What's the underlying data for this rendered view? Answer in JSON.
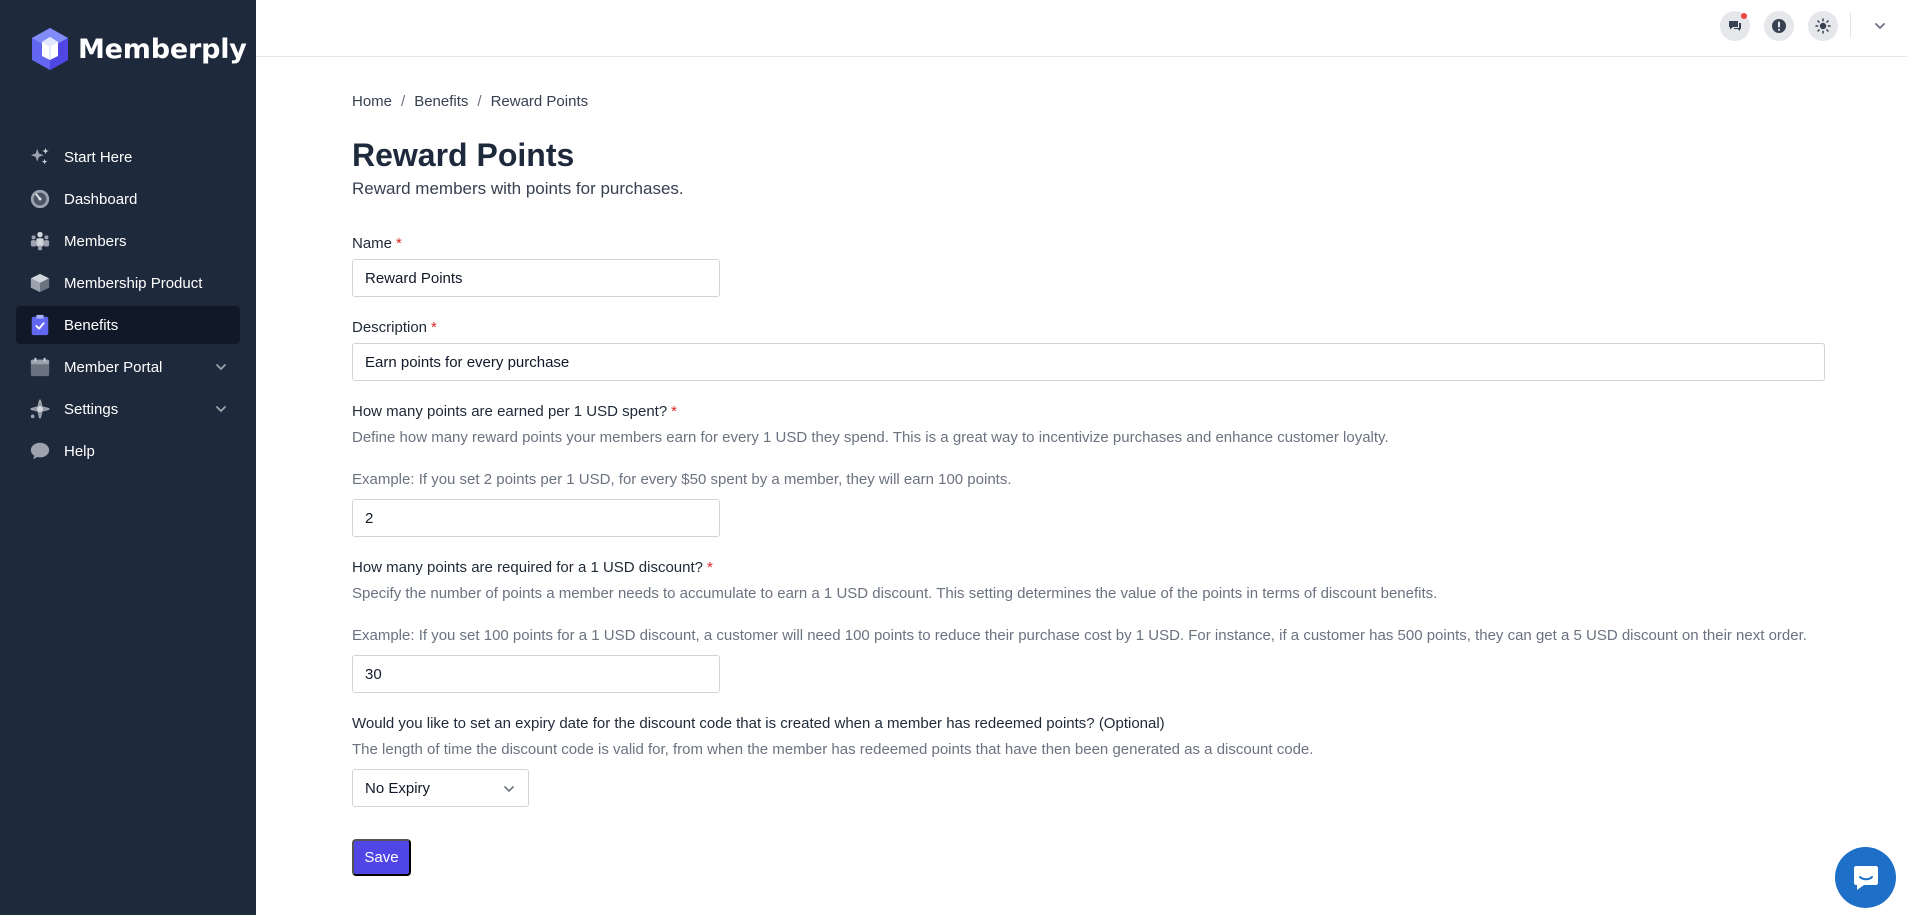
{
  "app": {
    "name": "Memberply"
  },
  "sidebar": {
    "items": [
      {
        "label": "Start Here",
        "icon": "sparkles-icon"
      },
      {
        "label": "Dashboard",
        "icon": "gauge-icon"
      },
      {
        "label": "Members",
        "icon": "users-icon"
      },
      {
        "label": "Membership Product",
        "icon": "cube-icon"
      },
      {
        "label": "Benefits",
        "icon": "clipboard-check-icon",
        "active": true
      },
      {
        "label": "Member Portal",
        "icon": "calendar-icon",
        "expandable": true
      },
      {
        "label": "Settings",
        "icon": "settings-icon",
        "expandable": true
      },
      {
        "label": "Help",
        "icon": "chat-bubble-icon"
      }
    ]
  },
  "topbar": {
    "icons": [
      "chat-icon",
      "alert-icon",
      "sun-icon",
      "chevron-down-icon"
    ]
  },
  "breadcrumb": [
    "Home",
    "Benefits",
    "Reward Points"
  ],
  "breadcrumb_separator": "/",
  "page": {
    "title": "Reward Points",
    "subtitle": "Reward members with points for purchases."
  },
  "form": {
    "required_mark": "*",
    "name": {
      "label": "Name",
      "value": "Reward Points"
    },
    "description": {
      "label": "Description",
      "value": "Earn points for every purchase"
    },
    "points_earned": {
      "label": "How many points are earned per 1 USD spent?",
      "help": "Define how many reward points your members earn for every 1 USD they spend. This is a great way to incentivize purchases and enhance customer loyalty.",
      "example": "Example: If you set 2 points per 1 USD, for every $50 spent by a member, they will earn 100 points.",
      "value": "2"
    },
    "points_required": {
      "label": "How many points are required for a 1 USD discount?",
      "help": "Specify the number of points a member needs to accumulate to earn a 1 USD discount. This setting determines the value of the points in terms of discount benefits.",
      "example": "Example: If you set 100 points for a 1 USD discount, a customer will need 100 points to reduce their purchase cost by 1 USD. For instance, if a customer has 500 points, they can get a 5 USD discount on their next order.",
      "value": "30"
    },
    "expiry": {
      "label": "Would you like to set an expiry date for the discount code that is created when a member has redeemed points? (Optional)",
      "help": "The length of time the discount code is valid for, from when the member has redeemed points that have then been generated as a discount code.",
      "value": "No Expiry"
    },
    "save_label": "Save"
  },
  "colors": {
    "sidebar_bg": "#1e293b",
    "active_item_bg": "#111827",
    "primary": "#4f46e5",
    "chat_fab": "#1d6fc7",
    "required": "#dc2626"
  }
}
